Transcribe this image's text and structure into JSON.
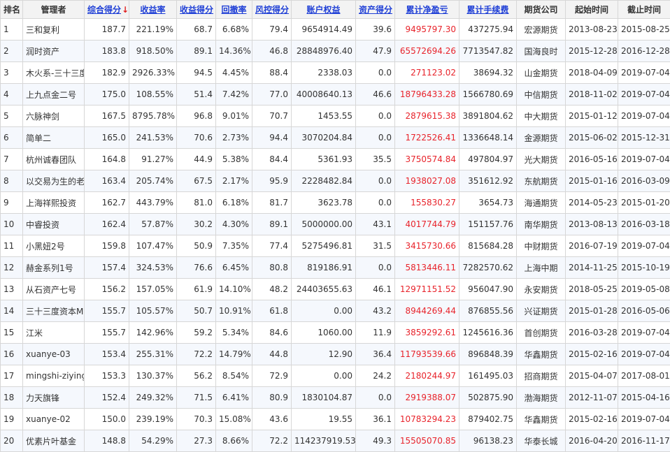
{
  "columns": [
    {
      "key": "rank",
      "label": "排名",
      "sortable": false
    },
    {
      "key": "manager",
      "label": "管理者",
      "sortable": false
    },
    {
      "key": "total_score",
      "label": "综合得分",
      "sortable": true,
      "sort_indicator": "↓"
    },
    {
      "key": "return_rate",
      "label": "收益率",
      "sortable": true
    },
    {
      "key": "return_score",
      "label": "收益得分",
      "sortable": true
    },
    {
      "key": "drawdown",
      "label": "回撤率",
      "sortable": true
    },
    {
      "key": "risk_score",
      "label": "风控得分",
      "sortable": true
    },
    {
      "key": "equity",
      "label": "账户权益",
      "sortable": true
    },
    {
      "key": "asset_score",
      "label": "资产得分",
      "sortable": true
    },
    {
      "key": "net_profit",
      "label": "累计净盈亏",
      "sortable": true
    },
    {
      "key": "fees",
      "label": "累计手续费",
      "sortable": true
    },
    {
      "key": "broker",
      "label": "期货公司",
      "sortable": false
    },
    {
      "key": "start",
      "label": "起始时间",
      "sortable": false
    },
    {
      "key": "end",
      "label": "截止时间",
      "sortable": false
    }
  ],
  "rows": [
    {
      "rank": "1",
      "manager": "三和复利",
      "total_score": "187.7",
      "return_rate": "221.19%",
      "return_score": "68.7",
      "drawdown": "6.68%",
      "risk_score": "79.4",
      "equity": "9654914.49",
      "asset_score": "39.6",
      "net_profit": "9495797.30",
      "fees": "437275.94",
      "broker": "宏源期货",
      "start": "2013-08-23",
      "end": "2015-08-25"
    },
    {
      "rank": "2",
      "manager": "润时资产",
      "total_score": "183.8",
      "return_rate": "918.50%",
      "return_score": "89.1",
      "drawdown": "14.36%",
      "risk_score": "46.8",
      "equity": "28848976.40",
      "asset_score": "47.9",
      "net_profit": "65572694.26",
      "fees": "7713547.82",
      "broker": "国海良时",
      "start": "2015-12-28",
      "end": "2016-12-28"
    },
    {
      "rank": "3",
      "manager": "木火系-三十三度",
      "total_score": "182.9",
      "return_rate": "2926.33%",
      "return_score": "94.5",
      "drawdown": "4.45%",
      "risk_score": "88.4",
      "equity": "2338.03",
      "asset_score": "0.0",
      "net_profit": "271123.02",
      "fees": "38694.32",
      "broker": "山金期货",
      "start": "2018-04-09",
      "end": "2019-07-04"
    },
    {
      "rank": "4",
      "manager": "上九点金二号",
      "total_score": "175.0",
      "return_rate": "108.55%",
      "return_score": "51.4",
      "drawdown": "7.42%",
      "risk_score": "77.0",
      "equity": "40008640.13",
      "asset_score": "46.6",
      "net_profit": "18796433.28",
      "fees": "1566780.69",
      "broker": "中信期货",
      "start": "2018-11-02",
      "end": "2019-07-04"
    },
    {
      "rank": "5",
      "manager": "六脉神剑",
      "total_score": "167.5",
      "return_rate": "8795.78%",
      "return_score": "96.8",
      "drawdown": "9.01%",
      "risk_score": "70.7",
      "equity": "1453.55",
      "asset_score": "0.0",
      "net_profit": "2879615.38",
      "fees": "3891804.62",
      "broker": "中大期货",
      "start": "2015-01-12",
      "end": "2019-07-04"
    },
    {
      "rank": "6",
      "manager": "简单二",
      "total_score": "165.0",
      "return_rate": "241.53%",
      "return_score": "70.6",
      "drawdown": "2.73%",
      "risk_score": "94.4",
      "equity": "3070204.84",
      "asset_score": "0.0",
      "net_profit": "1722526.41",
      "fees": "1336648.14",
      "broker": "金源期货",
      "start": "2015-06-02",
      "end": "2015-12-31"
    },
    {
      "rank": "7",
      "manager": "杭州诚春团队",
      "total_score": "164.8",
      "return_rate": "91.27%",
      "return_score": "44.9",
      "drawdown": "5.38%",
      "risk_score": "84.4",
      "equity": "5361.93",
      "asset_score": "35.5",
      "net_profit": "3750574.84",
      "fees": "497804.97",
      "broker": "光大期货",
      "start": "2016-05-16",
      "end": "2019-07-04"
    },
    {
      "rank": "8",
      "manager": "以交易为生的老",
      "total_score": "163.4",
      "return_rate": "205.74%",
      "return_score": "67.5",
      "drawdown": "2.17%",
      "risk_score": "95.9",
      "equity": "2228482.84",
      "asset_score": "0.0",
      "net_profit": "1938027.08",
      "fees": "351612.92",
      "broker": "东航期货",
      "start": "2015-01-16",
      "end": "2016-03-09"
    },
    {
      "rank": "9",
      "manager": "上海祥熙投资",
      "total_score": "162.7",
      "return_rate": "443.79%",
      "return_score": "81.0",
      "drawdown": "6.18%",
      "risk_score": "81.7",
      "equity": "3623.78",
      "asset_score": "0.0",
      "net_profit": "155830.27",
      "fees": "3654.73",
      "broker": "海通期货",
      "start": "2014-05-23",
      "end": "2015-01-20"
    },
    {
      "rank": "10",
      "manager": "中睿投资",
      "total_score": "162.4",
      "return_rate": "57.87%",
      "return_score": "30.2",
      "drawdown": "4.30%",
      "risk_score": "89.1",
      "equity": "5000000.00",
      "asset_score": "43.1",
      "net_profit": "4017744.79",
      "fees": "151157.76",
      "broker": "南华期货",
      "start": "2013-08-13",
      "end": "2016-03-18"
    },
    {
      "rank": "11",
      "manager": "小黑妞2号",
      "total_score": "159.8",
      "return_rate": "107.47%",
      "return_score": "50.9",
      "drawdown": "7.35%",
      "risk_score": "77.4",
      "equity": "5275496.81",
      "asset_score": "31.5",
      "net_profit": "3415730.66",
      "fees": "815684.28",
      "broker": "中财期货",
      "start": "2016-07-19",
      "end": "2019-07-04"
    },
    {
      "rank": "12",
      "manager": "赫金系列1号",
      "total_score": "157.4",
      "return_rate": "324.53%",
      "return_score": "76.6",
      "drawdown": "6.45%",
      "risk_score": "80.8",
      "equity": "819186.91",
      "asset_score": "0.0",
      "net_profit": "5813446.11",
      "fees": "7282570.62",
      "broker": "上海中期",
      "start": "2014-11-25",
      "end": "2015-10-19"
    },
    {
      "rank": "13",
      "manager": "从石资产七号",
      "total_score": "156.2",
      "return_rate": "157.05%",
      "return_score": "61.9",
      "drawdown": "14.10%",
      "risk_score": "48.2",
      "equity": "24403655.63",
      "asset_score": "46.1",
      "net_profit": "12971151.52",
      "fees": "956047.90",
      "broker": "永安期货",
      "start": "2018-05-25",
      "end": "2019-05-08"
    },
    {
      "rank": "14",
      "manager": "三十三度资本Mr",
      "total_score": "155.7",
      "return_rate": "105.57%",
      "return_score": "50.7",
      "drawdown": "10.91%",
      "risk_score": "61.8",
      "equity": "0.00",
      "asset_score": "43.2",
      "net_profit": "8944269.44",
      "fees": "876855.56",
      "broker": "兴证期货",
      "start": "2015-01-28",
      "end": "2016-05-06"
    },
    {
      "rank": "15",
      "manager": "江米",
      "total_score": "155.7",
      "return_rate": "142.96%",
      "return_score": "59.2",
      "drawdown": "5.34%",
      "risk_score": "84.6",
      "equity": "1060.00",
      "asset_score": "11.9",
      "net_profit": "3859292.61",
      "fees": "1245616.36",
      "broker": "首创期货",
      "start": "2016-03-28",
      "end": "2019-07-04"
    },
    {
      "rank": "16",
      "manager": "xuanye-03",
      "total_score": "153.4",
      "return_rate": "255.31%",
      "return_score": "72.2",
      "drawdown": "14.79%",
      "risk_score": "44.8",
      "equity": "12.90",
      "asset_score": "36.4",
      "net_profit": "11793539.66",
      "fees": "896848.39",
      "broker": "华鑫期货",
      "start": "2015-02-16",
      "end": "2019-07-04"
    },
    {
      "rank": "17",
      "manager": "mingshi-ziying",
      "total_score": "153.3",
      "return_rate": "130.37%",
      "return_score": "56.2",
      "drawdown": "8.54%",
      "risk_score": "72.9",
      "equity": "0.00",
      "asset_score": "24.2",
      "net_profit": "2180244.97",
      "fees": "161495.03",
      "broker": "招商期货",
      "start": "2015-04-07",
      "end": "2017-08-01"
    },
    {
      "rank": "18",
      "manager": "力天旗锋",
      "total_score": "152.4",
      "return_rate": "249.32%",
      "return_score": "71.5",
      "drawdown": "6.41%",
      "risk_score": "80.9",
      "equity": "1830104.87",
      "asset_score": "0.0",
      "net_profit": "2919388.07",
      "fees": "502875.90",
      "broker": "渤海期货",
      "start": "2012-11-07",
      "end": "2015-04-16"
    },
    {
      "rank": "19",
      "manager": "xuanye-02",
      "total_score": "150.0",
      "return_rate": "239.19%",
      "return_score": "70.3",
      "drawdown": "15.08%",
      "risk_score": "43.6",
      "equity": "19.55",
      "asset_score": "36.1",
      "net_profit": "10783294.23",
      "fees": "879402.75",
      "broker": "华鑫期货",
      "start": "2015-02-16",
      "end": "2019-07-04"
    },
    {
      "rank": "20",
      "manager": "优素片叶基金",
      "total_score": "148.8",
      "return_rate": "54.29%",
      "return_score": "27.3",
      "drawdown": "8.66%",
      "risk_score": "72.2",
      "equity": "114237919.53",
      "asset_score": "49.3",
      "net_profit": "15505070.85",
      "fees": "96138.23",
      "broker": "华泰长城",
      "start": "2016-04-20",
      "end": "2016-11-17"
    }
  ],
  "colors": {
    "header_bg": "#f3f3f3",
    "sort_link": "#1f3fd6",
    "sort_arrow": "#e02020",
    "profit_text": "#e8232b",
    "row_alt": "#f5f8fd",
    "border": "#d7d7d7"
  }
}
